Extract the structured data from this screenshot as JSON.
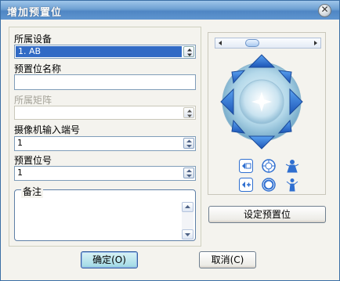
{
  "window": {
    "title": "增加预置位"
  },
  "form": {
    "device_label": "所属设备",
    "device_value": "1. AB",
    "preset_name_label": "预置位名称",
    "preset_name_value": "",
    "matrix_label": "所属矩阵",
    "matrix_value": "",
    "camera_port_label": "摄像机输入端号",
    "camera_port_value": "1",
    "preset_no_label": "预置位号",
    "preset_no_value": "1",
    "notes_label": "备注",
    "notes_value": ""
  },
  "ptz": {
    "set_preset_label": "设定预置位",
    "icons": [
      "zoom-out-icon",
      "iris-open-icon",
      "focus-near-icon",
      "zoom-in-icon",
      "iris-close-icon",
      "focus-far-icon"
    ]
  },
  "buttons": {
    "ok_label": "确定(O)",
    "cancel_label": "取消(C)"
  },
  "colors": {
    "title_bar": "#5f95cf",
    "accent": "#316ac5",
    "ptz_blue": "#2f6fd0"
  }
}
